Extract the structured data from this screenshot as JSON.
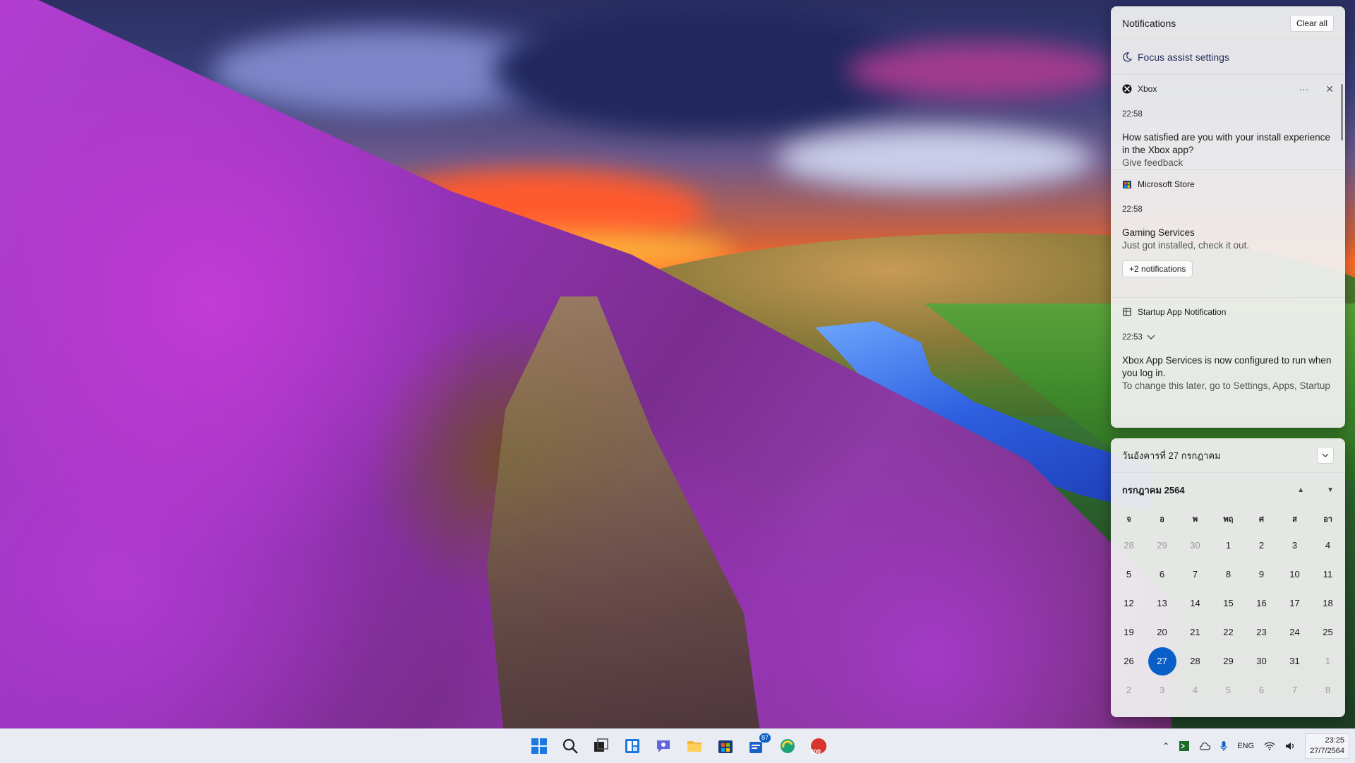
{
  "colors": {
    "accent": "#0a5ec8",
    "panel_bg": "#f0f0f0",
    "taskbar_bg": "#e9ecf3"
  },
  "notifications": {
    "title": "Notifications",
    "clear_all": "Clear all",
    "focus_assist": "Focus assist settings",
    "items": [
      {
        "app": "Xbox",
        "icon": "xbox-icon",
        "time": "22:58",
        "title": "How satisfied are you with your install experience in the Xbox app?",
        "body": "Give feedback",
        "more": "···"
      },
      {
        "app": "Microsoft Store",
        "icon": "store-icon",
        "time": "22:58",
        "title": "Gaming Services",
        "body": "Just got installed, check it out.",
        "extra_button": "+2 notifications"
      },
      {
        "app": "Startup App Notification",
        "icon": "startup-icon",
        "time": "22:53",
        "title": "Xbox App Services is now configured to run when you log in.",
        "body": "To change this later, go to Settings, Apps, Startup"
      }
    ]
  },
  "calendar": {
    "date_label": "วันอังคารที่ 27 กรกฎาคม",
    "month_label": "กรกฎาคม 2564",
    "weekdays": [
      "จ",
      "อ",
      "พ",
      "พฤ",
      "ศ",
      "ส",
      "อา"
    ],
    "weeks": [
      [
        "28",
        "29",
        "30",
        "1",
        "2",
        "3",
        "4"
      ],
      [
        "5",
        "6",
        "7",
        "8",
        "9",
        "10",
        "11"
      ],
      [
        "12",
        "13",
        "14",
        "15",
        "16",
        "17",
        "18"
      ],
      [
        "19",
        "20",
        "21",
        "22",
        "23",
        "24",
        "25"
      ],
      [
        "26",
        "27",
        "28",
        "29",
        "30",
        "31",
        "1"
      ],
      [
        "2",
        "3",
        "4",
        "5",
        "6",
        "7",
        "8"
      ]
    ],
    "today": "27"
  },
  "taskbar": {
    "badge_news": "87",
    "badge_app": "300",
    "language": "ENG",
    "time": "23:25",
    "date": "27/7/2564"
  }
}
